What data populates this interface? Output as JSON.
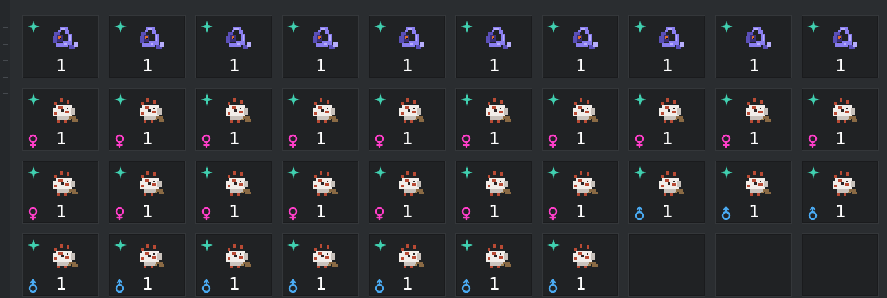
{
  "colors": {
    "shiny": "#40d0b0",
    "female": "#ff3ec9",
    "male": "#4aaaf2",
    "slot_background": "#202224",
    "page_background": "#2a2d30"
  },
  "inventory": {
    "slots": [
      {
        "species_icon": "purple-serpent-sprite-icon",
        "shiny": true,
        "gender": null,
        "quantity": "1"
      },
      {
        "species_icon": "purple-serpent-sprite-icon",
        "shiny": true,
        "gender": null,
        "quantity": "1"
      },
      {
        "species_icon": "purple-serpent-sprite-icon",
        "shiny": true,
        "gender": null,
        "quantity": "1"
      },
      {
        "species_icon": "purple-serpent-sprite-icon",
        "shiny": true,
        "gender": null,
        "quantity": "1"
      },
      {
        "species_icon": "purple-serpent-sprite-icon",
        "shiny": true,
        "gender": null,
        "quantity": "1"
      },
      {
        "species_icon": "purple-serpent-sprite-icon",
        "shiny": true,
        "gender": null,
        "quantity": "1"
      },
      {
        "species_icon": "purple-serpent-sprite-icon",
        "shiny": true,
        "gender": null,
        "quantity": "1"
      },
      {
        "species_icon": "purple-serpent-sprite-icon",
        "shiny": true,
        "gender": null,
        "quantity": "1"
      },
      {
        "species_icon": "purple-serpent-sprite-icon",
        "shiny": true,
        "gender": null,
        "quantity": "1"
      },
      {
        "species_icon": "purple-serpent-sprite-icon",
        "shiny": true,
        "gender": null,
        "quantity": "1"
      },
      {
        "species_icon": "white-cow-sprite-icon",
        "shiny": true,
        "gender": "female",
        "quantity": "1"
      },
      {
        "species_icon": "white-cow-sprite-icon",
        "shiny": true,
        "gender": "female",
        "quantity": "1"
      },
      {
        "species_icon": "white-cow-sprite-icon",
        "shiny": true,
        "gender": "female",
        "quantity": "1"
      },
      {
        "species_icon": "white-cow-sprite-icon",
        "shiny": true,
        "gender": "female",
        "quantity": "1"
      },
      {
        "species_icon": "white-cow-sprite-icon",
        "shiny": true,
        "gender": "female",
        "quantity": "1"
      },
      {
        "species_icon": "white-cow-sprite-icon",
        "shiny": true,
        "gender": "female",
        "quantity": "1"
      },
      {
        "species_icon": "white-cow-sprite-icon",
        "shiny": true,
        "gender": "female",
        "quantity": "1"
      },
      {
        "species_icon": "white-cow-sprite-icon",
        "shiny": true,
        "gender": "female",
        "quantity": "1"
      },
      {
        "species_icon": "white-cow-sprite-icon",
        "shiny": true,
        "gender": "female",
        "quantity": "1"
      },
      {
        "species_icon": "white-cow-sprite-icon",
        "shiny": true,
        "gender": "female",
        "quantity": "1"
      },
      {
        "species_icon": "white-cow-sprite-icon",
        "shiny": true,
        "gender": "female",
        "quantity": "1"
      },
      {
        "species_icon": "white-cow-sprite-icon",
        "shiny": true,
        "gender": "female",
        "quantity": "1"
      },
      {
        "species_icon": "white-cow-sprite-icon",
        "shiny": true,
        "gender": "female",
        "quantity": "1"
      },
      {
        "species_icon": "white-cow-sprite-icon",
        "shiny": true,
        "gender": "female",
        "quantity": "1"
      },
      {
        "species_icon": "white-cow-sprite-icon",
        "shiny": true,
        "gender": "female",
        "quantity": "1"
      },
      {
        "species_icon": "white-cow-sprite-icon",
        "shiny": true,
        "gender": "female",
        "quantity": "1"
      },
      {
        "species_icon": "white-cow-sprite-icon",
        "shiny": true,
        "gender": "female",
        "quantity": "1"
      },
      {
        "species_icon": "white-cow-sprite-icon",
        "shiny": true,
        "gender": "male",
        "quantity": "1"
      },
      {
        "species_icon": "white-cow-sprite-icon",
        "shiny": true,
        "gender": "male",
        "quantity": "1"
      },
      {
        "species_icon": "white-cow-sprite-icon",
        "shiny": true,
        "gender": "male",
        "quantity": "1"
      },
      {
        "species_icon": "white-cow-sprite-icon",
        "shiny": true,
        "gender": "male",
        "quantity": "1"
      },
      {
        "species_icon": "white-cow-sprite-icon",
        "shiny": true,
        "gender": "male",
        "quantity": "1"
      },
      {
        "species_icon": "white-cow-sprite-icon",
        "shiny": true,
        "gender": "male",
        "quantity": "1"
      },
      {
        "species_icon": "white-cow-sprite-icon",
        "shiny": true,
        "gender": "male",
        "quantity": "1"
      },
      {
        "species_icon": "white-cow-sprite-icon",
        "shiny": true,
        "gender": "male",
        "quantity": "1"
      },
      {
        "species_icon": "white-cow-sprite-icon",
        "shiny": true,
        "gender": "male",
        "quantity": "1"
      },
      {
        "species_icon": "white-cow-sprite-icon",
        "shiny": true,
        "gender": "male",
        "quantity": "1"
      },
      null,
      null,
      null
    ]
  }
}
